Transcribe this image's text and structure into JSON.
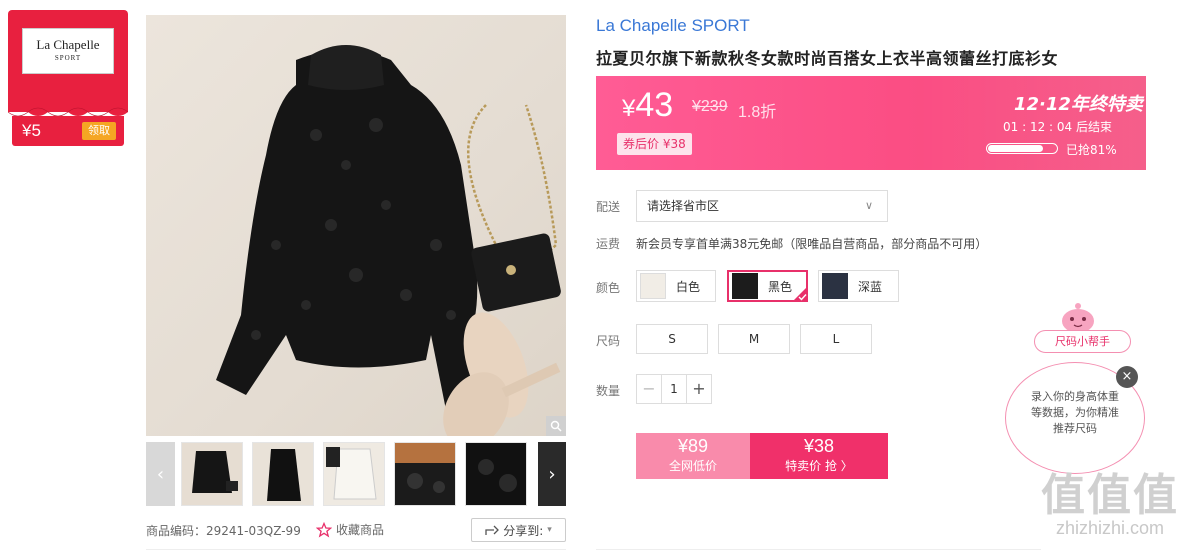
{
  "coupon": {
    "logo_line1": "La Chapelle",
    "logo_line2": "SPORT",
    "amount": "¥5",
    "claim_label": "领取"
  },
  "gallery": {
    "sku_label": "商品编码：29241-03QZ-99",
    "favorite_label": "收藏商品",
    "share_label": "分享到:",
    "thumbs": [
      "black-top-with-bag",
      "black-top-plain",
      "white-top",
      "lace-detail-1",
      "lace-detail-2"
    ]
  },
  "product": {
    "brand": "La Chapelle SPORT",
    "title": "拉夏贝尔旗下新款秋冬女款时尚百搭女上衣半高领蕾丝打底衫女"
  },
  "price": {
    "yen": "¥",
    "current": "43",
    "original": "¥239",
    "discount": "1.8折",
    "coupon_price": "券后价 ¥38",
    "promo_title": "12·12年终特卖",
    "countdown": "01 : 12 : 04  后结束",
    "progress_text": "已抢81%",
    "progress_fraction": 0.81
  },
  "delivery": {
    "label": "配送",
    "select_value": "请选择省市区"
  },
  "shipping": {
    "label": "运费",
    "text": "新会员专享首单满38元免邮（限唯品自营商品，部分商品不可用）"
  },
  "colors": {
    "label": "颜色",
    "options": [
      {
        "name": "白色",
        "swatch": "#f1ede6",
        "selected": false
      },
      {
        "name": "黑色",
        "swatch": "#1c1c1c",
        "selected": true
      },
      {
        "name": "深蓝",
        "swatch": "#2b3242",
        "selected": false
      }
    ]
  },
  "sizes": {
    "label": "尺码",
    "options": [
      "S",
      "M",
      "L"
    ]
  },
  "quantity": {
    "label": "数量",
    "minus": "−",
    "value": "1",
    "plus": "+"
  },
  "buy": {
    "left_price": "¥89",
    "left_sub": "全网低价",
    "right_price": "¥38",
    "right_sub": "特卖价 抢 〉"
  },
  "size_helper": {
    "label": "尺码小帮手",
    "bubble_text": "录入你的身高体重等数据，为你精准推荐尺码",
    "close": "×"
  },
  "watermark": {
    "line1": "值值值",
    "line2": "zhizhizhi.com"
  },
  "colors_theme": {
    "accent": "#f0306a",
    "brand_blue": "#3a78d6",
    "coupon_red": "#e8203f"
  }
}
